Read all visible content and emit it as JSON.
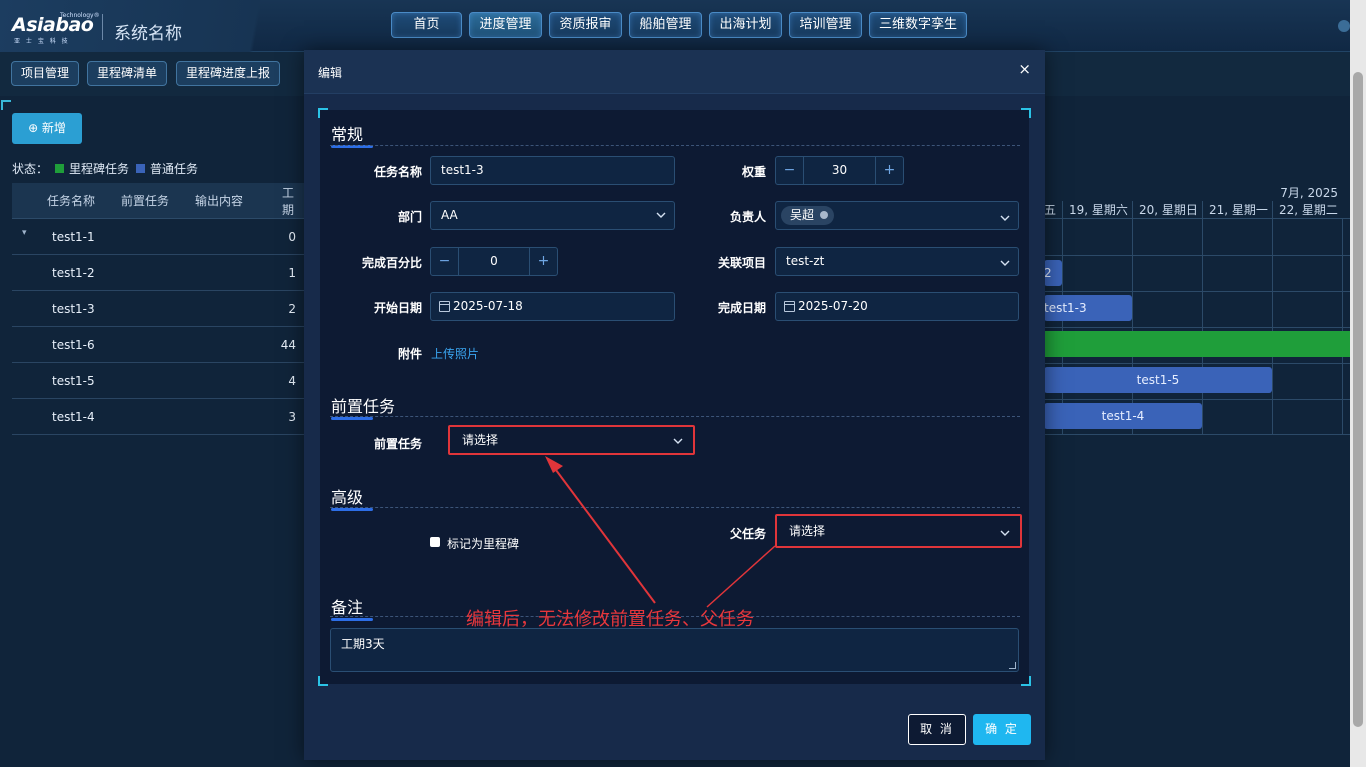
{
  "header": {
    "logo_text": "Asiabao",
    "logo_tech": "Technology®",
    "logo_sub": "亚 士 宝 科 技",
    "system_name": "系统名称",
    "nav": [
      "首页",
      "进度管理",
      "资质报审",
      "船舶管理",
      "出海计划",
      "培训管理",
      "三维数字孪生"
    ],
    "active_nav": "进度管理"
  },
  "subnav": [
    "项目管理",
    "里程碑清单",
    "里程碑进度上报"
  ],
  "toolbar": {
    "add_label": "⊕ 新增"
  },
  "status": {
    "label": "状态：",
    "legend": [
      {
        "name": "里程碑任务",
        "color": "#1f9e3a"
      },
      {
        "name": "普通任务",
        "color": "#3a63b8"
      }
    ]
  },
  "task_table": {
    "columns": [
      "任务名称",
      "前置任务",
      "输出内容",
      "工期"
    ],
    "rows": [
      {
        "name": "test1-1",
        "duration": "0"
      },
      {
        "name": "test1-2",
        "duration": "1"
      },
      {
        "name": "test1-3",
        "duration": "2"
      },
      {
        "name": "test1-6",
        "duration": "44"
      },
      {
        "name": "test1-5",
        "duration": "4"
      },
      {
        "name": "test1-4",
        "duration": "3"
      }
    ]
  },
  "gantt": {
    "month": "7月, 2025",
    "days": [
      "五",
      "19, 星期六",
      "20, 星期日",
      "21, 星期一",
      "22, 星期二"
    ],
    "bars": {
      "b2": "2",
      "b3": "test1-3",
      "b5": "test1-5",
      "b4": "test1-4"
    }
  },
  "modal": {
    "title": "编辑",
    "close": "×",
    "sections": {
      "general": "常规",
      "predecessor": "前置任务",
      "advanced": "高级",
      "remark": "备注"
    },
    "fields": {
      "task_name_label": "任务名称",
      "task_name_value": "test1-3",
      "weight_label": "权重",
      "weight_value": "30",
      "dept_label": "部门",
      "dept_value": "AA",
      "owner_label": "负责人",
      "owner_value": "吴超",
      "percent_label": "完成百分比",
      "percent_value": "0",
      "project_label": "关联项目",
      "project_value": "test-zt",
      "start_label": "开始日期",
      "start_value": "2025-07-18",
      "end_label": "完成日期",
      "end_value": "2025-07-20",
      "attach_label": "附件",
      "attach_link": "上传照片",
      "pred_label": "前置任务",
      "pred_placeholder": "请选择",
      "milestone_label": "标记为里程碑",
      "parent_label": "父任务",
      "parent_placeholder": "请选择",
      "remark_value": "工期3天"
    },
    "minus": "−",
    "plus": "+",
    "cancel": "取 消",
    "ok": "确 定"
  },
  "annotation": "编辑后，无法修改前置任务、父任务"
}
